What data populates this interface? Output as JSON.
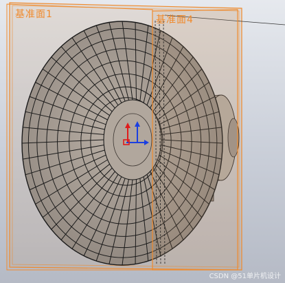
{
  "viewport": {
    "planes": [
      {
        "label": "基准面1",
        "color": "#f08a2c"
      },
      {
        "label": "基准面4",
        "color": "#f08a2c"
      }
    ],
    "model_color": "#a09890",
    "mesh_color": "#1a1a1a",
    "axis_colors": {
      "x": "#e01b1b",
      "y": "#1b3fe0"
    },
    "watermark": "CSDN @51单片机设计"
  }
}
